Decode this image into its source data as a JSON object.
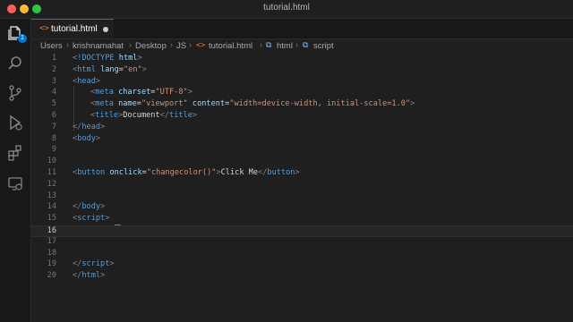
{
  "window": {
    "title": "tutorial.html"
  },
  "activity_bar": {
    "items": [
      {
        "name": "explorer-icon",
        "badge": "1"
      },
      {
        "name": "search-icon"
      },
      {
        "name": "source-control-icon"
      },
      {
        "name": "run-debug-icon"
      },
      {
        "name": "extensions-icon"
      },
      {
        "name": "remote-explorer-icon"
      }
    ]
  },
  "tab": {
    "label": "tutorial.html",
    "icon": "<>",
    "unsaved": true
  },
  "breadcrumb": {
    "parts": [
      "Users",
      "krishnamahat",
      "Desktop",
      "JS",
      "tutorial.html",
      "html",
      "script"
    ],
    "separator": "›"
  },
  "editor": {
    "current_line": 16,
    "lines": [
      {
        "n": "1",
        "tokens": [
          [
            "t",
            "<"
          ],
          [
            "tag",
            "!DOCTYPE"
          ],
          [
            "txt",
            " "
          ],
          [
            "attr",
            "html"
          ],
          [
            "t",
            ">"
          ]
        ]
      },
      {
        "n": "2",
        "tokens": [
          [
            "t",
            "<"
          ],
          [
            "tag",
            "html"
          ],
          [
            "txt",
            " "
          ],
          [
            "attr",
            "lang"
          ],
          [
            "txt",
            "="
          ],
          [
            "str",
            "\"en\""
          ],
          [
            "t",
            ">"
          ]
        ]
      },
      {
        "n": "3",
        "tokens": [
          [
            "t",
            "<"
          ],
          [
            "tag",
            "head"
          ],
          [
            "t",
            ">"
          ]
        ]
      },
      {
        "n": "4",
        "indent": 1,
        "tokens": [
          [
            "t",
            "<"
          ],
          [
            "tag",
            "meta"
          ],
          [
            "txt",
            " "
          ],
          [
            "attr",
            "charset"
          ],
          [
            "txt",
            "="
          ],
          [
            "str",
            "\"UTF-8\""
          ],
          [
            "t",
            ">"
          ]
        ]
      },
      {
        "n": "5",
        "indent": 1,
        "tokens": [
          [
            "t",
            "<"
          ],
          [
            "tag",
            "meta"
          ],
          [
            "txt",
            " "
          ],
          [
            "attr",
            "name"
          ],
          [
            "txt",
            "="
          ],
          [
            "str",
            "\"viewport\""
          ],
          [
            "txt",
            " "
          ],
          [
            "attr",
            "content"
          ],
          [
            "txt",
            "="
          ],
          [
            "str",
            "\"width=device-width, initial-scale=1.0\""
          ],
          [
            "t",
            ">"
          ]
        ]
      },
      {
        "n": "6",
        "indent": 1,
        "tokens": [
          [
            "t",
            "<"
          ],
          [
            "tag",
            "title"
          ],
          [
            "t",
            ">"
          ],
          [
            "txt",
            "Document"
          ],
          [
            "t",
            "</"
          ],
          [
            "tag",
            "title"
          ],
          [
            "t",
            ">"
          ]
        ]
      },
      {
        "n": "7",
        "tokens": [
          [
            "t",
            "</"
          ],
          [
            "tag",
            "head"
          ],
          [
            "t",
            ">"
          ]
        ]
      },
      {
        "n": "8",
        "tokens": [
          [
            "t",
            "<"
          ],
          [
            "tag",
            "body"
          ],
          [
            "t",
            ">"
          ]
        ]
      },
      {
        "n": "9",
        "tokens": []
      },
      {
        "n": "10",
        "tokens": []
      },
      {
        "n": "11",
        "tokens": [
          [
            "t",
            "<"
          ],
          [
            "tag",
            "button"
          ],
          [
            "txt",
            " "
          ],
          [
            "attr",
            "onclick"
          ],
          [
            "txt",
            "="
          ],
          [
            "str",
            "\"changecolor()\""
          ],
          [
            "t",
            ">"
          ],
          [
            "txt",
            "Click Me"
          ],
          [
            "t",
            "</"
          ],
          [
            "tag",
            "button"
          ],
          [
            "t",
            ">"
          ]
        ]
      },
      {
        "n": "12",
        "tokens": []
      },
      {
        "n": "13",
        "tokens": []
      },
      {
        "n": "14",
        "tokens": [
          [
            "t",
            "</"
          ],
          [
            "tag",
            "body"
          ],
          [
            "t",
            ">"
          ]
        ]
      },
      {
        "n": "15",
        "tokens": [
          [
            "t",
            "<"
          ],
          [
            "tag",
            "script"
          ],
          [
            "t",
            ">"
          ]
        ]
      },
      {
        "n": "16",
        "tokens": []
      },
      {
        "n": "17",
        "tokens": []
      },
      {
        "n": "18",
        "tokens": []
      },
      {
        "n": "19",
        "tokens": [
          [
            "t",
            "</"
          ],
          [
            "tag",
            "script"
          ],
          [
            "t",
            ">"
          ]
        ]
      },
      {
        "n": "20",
        "tokens": [
          [
            "t",
            "</"
          ],
          [
            "tag",
            "html"
          ],
          [
            "t",
            ">"
          ]
        ]
      }
    ]
  }
}
